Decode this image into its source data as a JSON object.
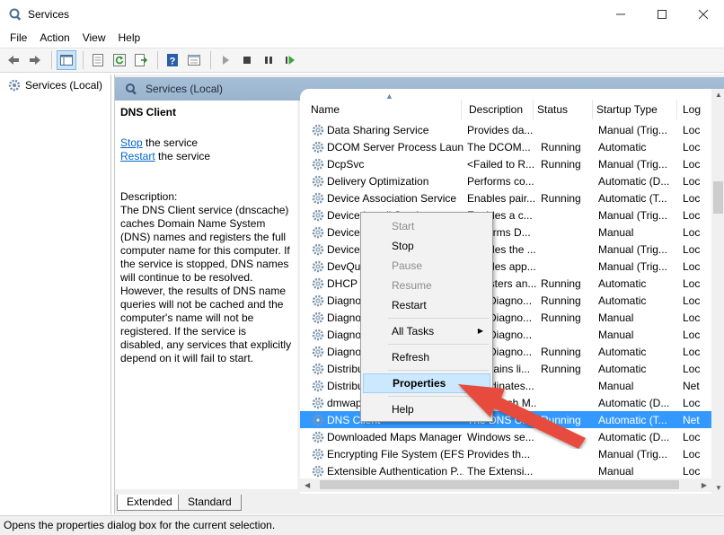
{
  "window": {
    "title": "Services",
    "controls": [
      "minimize",
      "maximize",
      "close"
    ]
  },
  "menu": [
    "File",
    "Action",
    "View",
    "Help"
  ],
  "toolbar": [
    "back-icon",
    "forward-icon",
    "show-hide-console-tree-icon",
    "properties-icon",
    "refresh-icon",
    "export-list-icon",
    "help-icon",
    "view-icon",
    "start-service-icon",
    "stop-service-icon",
    "pause-service-icon",
    "restart-service-icon"
  ],
  "tree": {
    "root_label": "Services (Local)"
  },
  "pane": {
    "header": "Services (Local)"
  },
  "details": {
    "service_name": "DNS Client",
    "stop_link": "Stop",
    "stop_suffix": " the service",
    "restart_link": "Restart",
    "restart_suffix": " the service",
    "description_label": "Description:",
    "description": "The DNS Client service (dnscache) caches Domain Name System (DNS) names and registers the full computer name for this computer. If the service is stopped, DNS names will continue to be resolved. However, the results of DNS name queries will not be cached and the computer's name will not be registered. If the service is disabled, any services that explicitly depend on it will fail to start."
  },
  "columns": [
    "Name",
    "Description",
    "Status",
    "Startup Type",
    "Log"
  ],
  "rows": [
    {
      "name": "Data Sharing Service",
      "desc": "Provides da...",
      "status": "",
      "startup": "Manual (Trig...",
      "log": "Loc"
    },
    {
      "name": "DCOM Server Process Laun...",
      "desc": "The DCOM...",
      "status": "Running",
      "startup": "Automatic",
      "log": "Loc"
    },
    {
      "name": "DcpSvc",
      "desc": "<Failed to R...",
      "status": "Running",
      "startup": "Manual (Trig...",
      "log": "Loc"
    },
    {
      "name": "Delivery Optimization",
      "desc": "Performs co...",
      "status": "",
      "startup": "Automatic (D...",
      "log": "Loc"
    },
    {
      "name": "Device Association Service",
      "desc": "Enables pair...",
      "status": "Running",
      "startup": "Automatic (T...",
      "log": "Loc"
    },
    {
      "name": "Device Install Service",
      "desc": "Enables a c...",
      "status": "",
      "startup": "Manual (Trig...",
      "log": "Loc"
    },
    {
      "name": "Device Setup Manager",
      "desc": "Performs D...",
      "status": "",
      "startup": "Manual",
      "log": "Loc"
    },
    {
      "name": "Device Management",
      "desc": "Enables the ...",
      "status": "",
      "startup": "Manual (Trig...",
      "log": "Loc"
    },
    {
      "name": "DevQuery Background",
      "desc": "Enables app...",
      "status": "",
      "startup": "Manual (Trig...",
      "log": "Loc"
    },
    {
      "name": "DHCP Client",
      "desc": "Registers an...",
      "status": "Running",
      "startup": "Automatic",
      "log": "Loc"
    },
    {
      "name": "Diagnostic Policy",
      "desc": "The Diagno...",
      "status": "Running",
      "startup": "Automatic",
      "log": "Loc"
    },
    {
      "name": "Diagnostic Service Host",
      "desc": "The Diagno...",
      "status": "Running",
      "startup": "Manual",
      "log": "Loc"
    },
    {
      "name": "Diagnostic System Host",
      "desc": "The Diagno...",
      "status": "",
      "startup": "Manual",
      "log": "Loc"
    },
    {
      "name": "Diagnostics Tracking",
      "desc": "The Diagno...",
      "status": "Running",
      "startup": "Automatic",
      "log": "Loc"
    },
    {
      "name": "Distributed Link",
      "desc": "Maintains li...",
      "status": "Running",
      "startup": "Automatic",
      "log": "Loc"
    },
    {
      "name": "Distributed Transaction",
      "desc": "Coordinates...",
      "status": "",
      "startup": "Manual",
      "log": "Net"
    },
    {
      "name": "dmwappushservice",
      "desc": "WAP Push M...",
      "status": "",
      "startup": "Automatic (D...",
      "log": "Loc"
    },
    {
      "name": "DNS Client",
      "desc": "The DNS Cl...",
      "status": "Running",
      "startup": "Automatic (T...",
      "log": "Net",
      "selected": true
    },
    {
      "name": "Downloaded Maps Manager",
      "desc": "Windows se...",
      "status": "",
      "startup": "Automatic (D...",
      "log": "Loc"
    },
    {
      "name": "Encrypting File System (EFS)",
      "desc": "Provides th...",
      "status": "",
      "startup": "Manual (Trig...",
      "log": "Loc"
    },
    {
      "name": "Extensible Authentication P...",
      "desc": "The Extensi...",
      "status": "",
      "startup": "Manual",
      "log": "Loc"
    }
  ],
  "context_menu": {
    "start": "Start",
    "stop": "Stop",
    "pause": "Pause",
    "resume": "Resume",
    "restart": "Restart",
    "all_tasks": "All Tasks",
    "refresh": "Refresh",
    "properties": "Properties",
    "help": "Help"
  },
  "tabs": {
    "extended": "Extended",
    "standard": "Standard"
  },
  "status_bar": "Opens the properties dialog box for the current selection.",
  "colors": {
    "selection": "#3399ff",
    "header_band": "#a6bfd7",
    "link": "#0066cc",
    "annotation_arrow": "#e74c3c"
  }
}
